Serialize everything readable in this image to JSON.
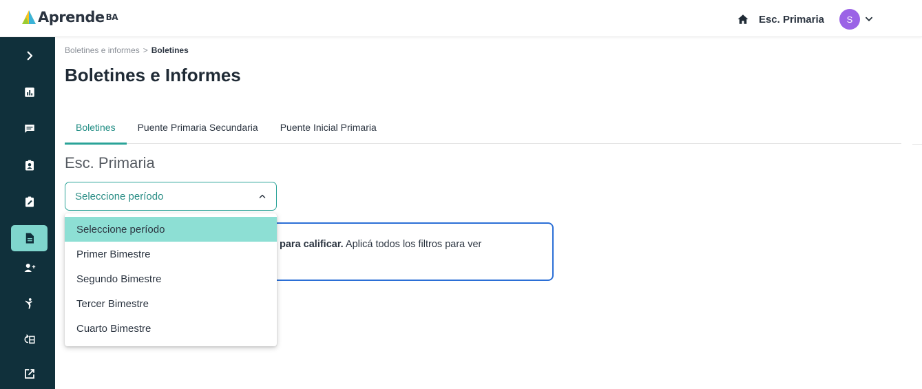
{
  "header": {
    "logo_text": "Aprende",
    "logo_suffix": "BA",
    "school": "Esc. Primaria",
    "avatar_initial": "S"
  },
  "sidebar": {
    "items": [
      {
        "icon": "chevron-right-icon"
      },
      {
        "icon": "bar-chart-icon"
      },
      {
        "icon": "chat-icon"
      },
      {
        "icon": "badge-icon"
      },
      {
        "icon": "clipboard-edit-icon"
      },
      {
        "icon": "document-icon",
        "active": true
      },
      {
        "icon": "add-user-icon"
      },
      {
        "icon": "person-icon"
      },
      {
        "icon": "sync-list-icon"
      },
      {
        "icon": "external-link-icon"
      }
    ]
  },
  "breadcrumb": {
    "parent": "Boletines e informes",
    "separator": ">",
    "current": "Boletines"
  },
  "page_title": "Boletines e Informes",
  "tabs": [
    {
      "label": "Boletines",
      "active": true
    },
    {
      "label": "Puente Primaria Secundaria"
    },
    {
      "label": "Puente Inicial Primaria"
    }
  ],
  "section_title": "Esc. Primaria",
  "period_select": {
    "value": "Seleccione período",
    "options": [
      {
        "label": "Seleccione período",
        "selected": true
      },
      {
        "label": "Primer Bimestre"
      },
      {
        "label": "Segundo Bimestre"
      },
      {
        "label": "Tercer Bimestre"
      },
      {
        "label": "Cuarto Bimestre"
      }
    ]
  },
  "info": {
    "bold": "para calificar.",
    "text": " Aplicá todos los filtros para ver"
  },
  "colors": {
    "sidebar_bg": "#10303b",
    "accent": "#2aa398",
    "active_item": "#7fd6cd",
    "dropdown_selected": "#8ddfd4",
    "info_border": "#2b6fd6",
    "avatar": "#9b63e6"
  }
}
